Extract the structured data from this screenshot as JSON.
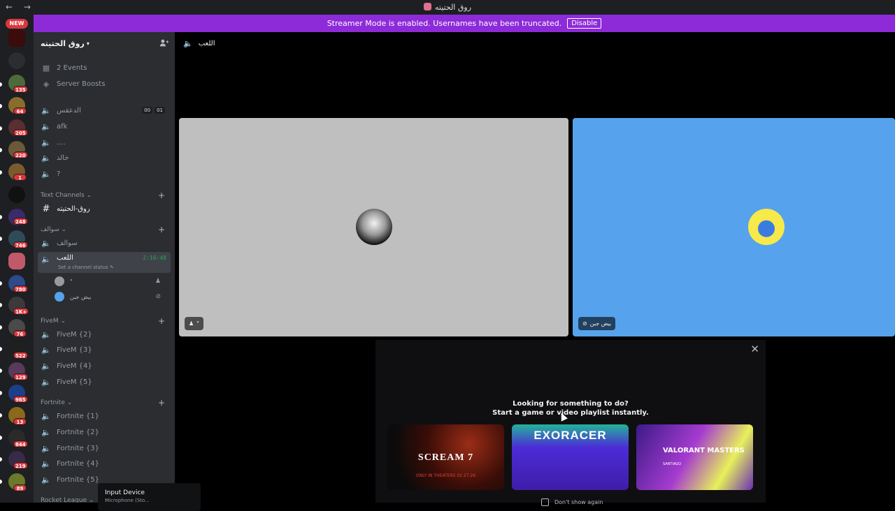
{
  "titlebar": {
    "nav": "← →",
    "title": "روق الحتيته"
  },
  "banner": {
    "text": "Streamer Mode is enabled. Usernames have been truncated.",
    "button": "Disable",
    "color": "#8d2bd9"
  },
  "rail": {
    "new_label": "NEW",
    "badges": [
      "135",
      "64",
      "205",
      "220",
      "1",
      "248",
      "746",
      "780",
      "1K+",
      "76",
      "522",
      "129",
      "965",
      "13",
      "844",
      "219",
      "89"
    ]
  },
  "server": {
    "name": "روق الحتيته",
    "events": "2 Events",
    "boosts": "Server Boosts",
    "voice_channels_top": [
      "الدعقس",
      "afk",
      "....",
      "خالد",
      "?"
    ],
    "counter": [
      "00",
      "01"
    ],
    "categories": {
      "text": "Text Channels",
      "sawalef": "سوالف",
      "fivem": "FiveM",
      "fortnite": "Fortnite",
      "rocket": "Rocket League"
    },
    "text_channel": "روق-الحتيته",
    "sawalef_channel": "سوالف",
    "active_channel": "اللعب",
    "active_timer": "2:16:48",
    "active_status": "Set a channel status",
    "voice_users": [
      "\"",
      "بيض جبن"
    ],
    "fivem_channels": [
      "FiveM {2}",
      "FiveM {3}",
      "FiveM {4}",
      "FiveM {5}"
    ],
    "fortnite_channels": [
      "Fortnite {1}",
      "Fortnite {2}",
      "Fortnite {3}",
      "Fortnite {4}",
      "Fortnite {5}"
    ]
  },
  "tooltip": {
    "title": "Input Device",
    "sub": "Microphone (Sto..."
  },
  "main": {
    "channel_name": "اللعب",
    "tiles": [
      {
        "name": "\"",
        "color": "#c0bfc0"
      },
      {
        "name": "بيض جبن",
        "color": "#56a2ec"
      }
    ]
  },
  "activity": {
    "line1": "Looking for something to do?",
    "line2": "Start a game or video playlist instantly.",
    "cards": [
      {
        "title": "SCREAM 7",
        "sub": "ONLY IN THEATERS 02.27.26"
      },
      {
        "title": "EXORACER"
      },
      {
        "title": "VALORANT MASTERS",
        "sub": "SANTIAGO"
      }
    ],
    "dont_show": "Don't show again"
  }
}
